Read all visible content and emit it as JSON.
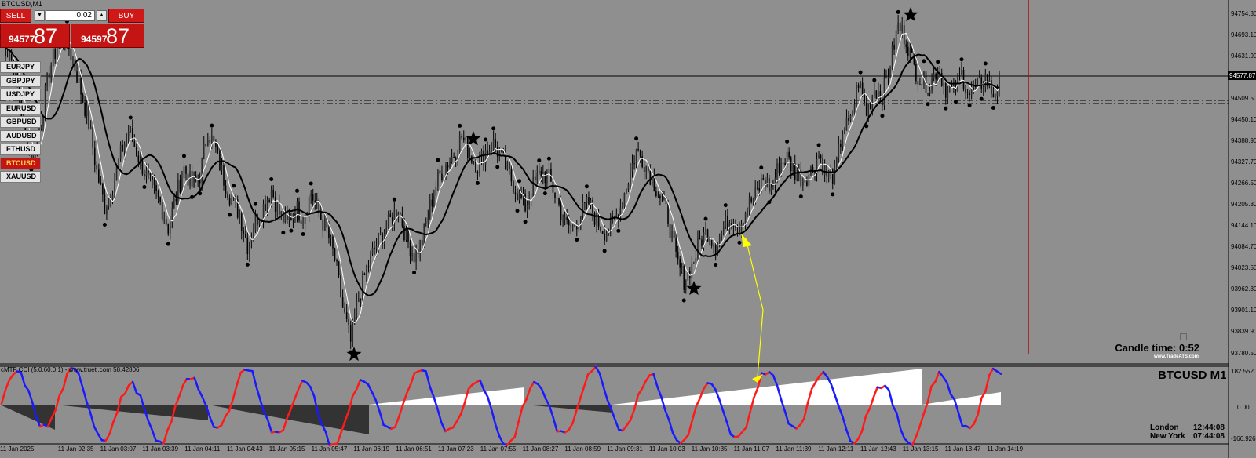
{
  "window": {
    "title": "BTCUSD,M1"
  },
  "trade_panel": {
    "sell_label": "SELL",
    "buy_label": "BUY",
    "lot_value": "0.02",
    "sell_price_small": "94577",
    "sell_price_big": "87",
    "buy_price_small": "94597",
    "buy_price_big": "87",
    "colors": {
      "panel": "#c41414"
    }
  },
  "symbols": [
    "EURJPY",
    "GBPJPY",
    "USDJPY",
    "EURUSD",
    "GBPUSD",
    "AUDUSD",
    "ETHUSD",
    "BTCUSD",
    "XAUUSD"
  ],
  "active_symbol": "BTCUSD",
  "price_axis": {
    "labels": [
      "94754.30",
      "94693.10",
      "94631.90",
      "94509.50",
      "94450.10",
      "94388.90",
      "94327.70",
      "94266.50",
      "94205.30",
      "94144.10",
      "94084.70",
      "94023.50",
      "93962.30",
      "93901.10",
      "93839.90",
      "93780.50"
    ],
    "current_price": "94577.87"
  },
  "time_axis": {
    "labels": [
      "11 Jan 2025",
      "11 Jan 02:35",
      "11 Jan 03:07",
      "11 Jan 03:39",
      "11 Jan 04:11",
      "11 Jan 04:43",
      "11 Jan 05:15",
      "11 Jan 05:47",
      "11 Jan 06:19",
      "11 Jan 06:51",
      "11 Jan 07:23",
      "11 Jan 07:55",
      "11 Jan 08:27",
      "11 Jan 08:59",
      "11 Jan 09:31",
      "11 Jan 10:03",
      "11 Jan 10:35",
      "11 Jan 11:07",
      "11 Jan 11:39",
      "11 Jan 12:11",
      "11 Jan 12:43",
      "11 Jan 13:15",
      "11 Jan 13:47",
      "11 Jan 14:19"
    ]
  },
  "info": {
    "candle_time_label": "Candle time:",
    "candle_time_value": "0:52",
    "site": "www.TradeATS.com"
  },
  "indicator": {
    "label": "cMTF CCI (5.0.60.0.1) - www.truetl.com 58.42806",
    "axis": [
      "182.5520",
      "0.00",
      "-166.9261"
    ],
    "symbol_label": "BTCUSD  M1",
    "colors": {
      "rising": "#1a1aff",
      "falling": "#ff1a1a"
    }
  },
  "clocks": [
    {
      "city": "London",
      "time": "12:44:08"
    },
    {
      "city": "New York",
      "time": "07:44:08"
    }
  ],
  "price_series": [
    94672,
    94640,
    94555,
    94390,
    94340,
    94450,
    94590,
    94660,
    94690,
    94620,
    94530,
    94440,
    94300,
    94200,
    94260,
    94350,
    94420,
    94360,
    94300,
    94250,
    94210,
    94140,
    94230,
    94310,
    94260,
    94290,
    94420,
    94360,
    94280,
    94220,
    94180,
    94090,
    94160,
    94200,
    94250,
    94180,
    94150,
    94200,
    94170,
    94240,
    94180,
    94130,
    94050,
    93910,
    93810,
    93940,
    94020,
    94080,
    94120,
    94160,
    94200,
    94110,
    94060,
    94100,
    94200,
    94280,
    94320,
    94350,
    94400,
    94350,
    94320,
    94360,
    94380,
    94340,
    94290,
    94240,
    94200,
    94260,
    94300,
    94280,
    94220,
    94150,
    94140,
    94180,
    94210,
    94160,
    94130,
    94150,
    94200,
    94280,
    94360,
    94330,
    94280,
    94230,
    94170,
    94050,
    93990,
    94030,
    94100,
    94130,
    94090,
    94140,
    94170,
    94150,
    94200,
    94230,
    94280,
    94250,
    94320,
    94340,
    94300,
    94280,
    94300,
    94350,
    94290,
    94290,
    94420,
    94440,
    94560,
    94470,
    94540,
    94520,
    94610,
    94720,
    94680,
    94600,
    94560,
    94550,
    94600,
    94540,
    94530,
    94580,
    94520,
    94540,
    94570,
    94520,
    94570
  ]
}
